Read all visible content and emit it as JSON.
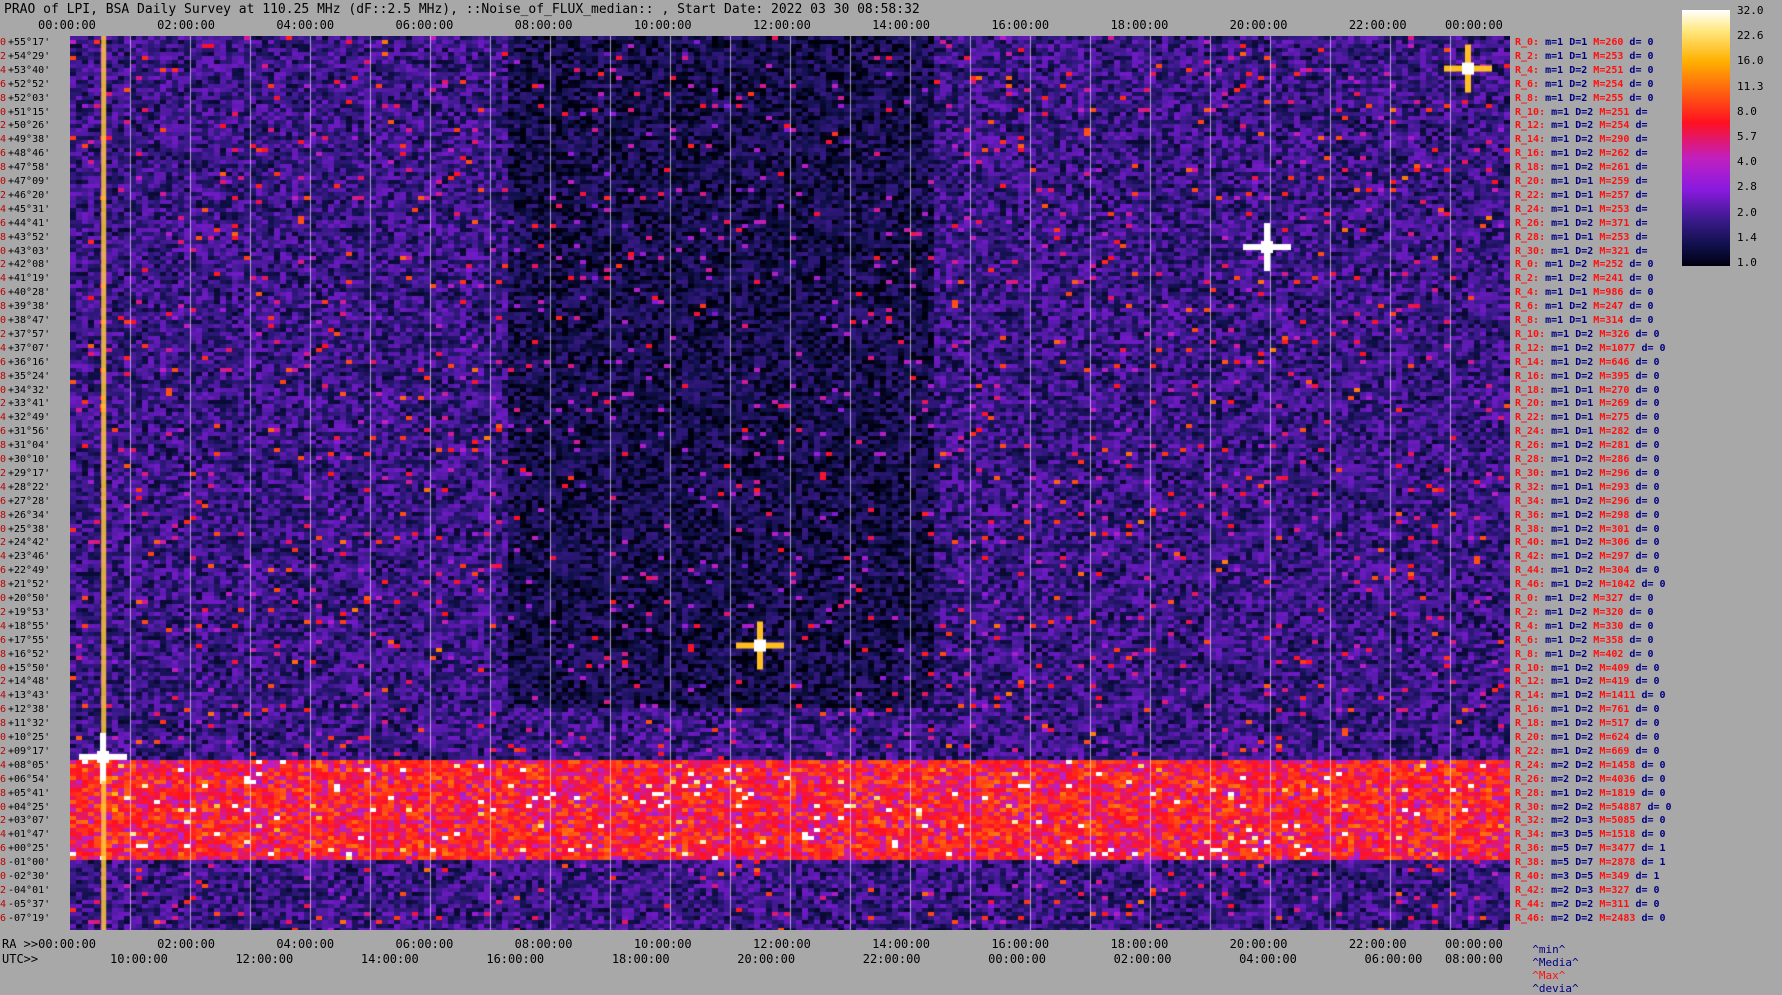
{
  "title": "PRAO of LPI, BSA Daily Survey at 110.25 MHz (dF::2.5 MHz), ::Noise_of_FLUX_median:: , Start Date: 2022 03 30 08:58:32",
  "top_ticks": [
    "00:00:00",
    "02:00:00",
    "04:00:00",
    "06:00:00",
    "08:00:00",
    "10:00:00",
    "12:00:00",
    "14:00:00",
    "16:00:00",
    "18:00:00",
    "20:00:00",
    "22:00:00",
    "00:00:00"
  ],
  "bottom_ra_label": "RA >>00:00:00",
  "bottom_ra_ticks": [
    "02:00:00",
    "04:00:00",
    "06:00:00",
    "08:00:00",
    "10:00:00",
    "12:00:00",
    "14:00:00",
    "16:00:00",
    "18:00:00",
    "20:00:00",
    "22:00:00",
    "00:00:00"
  ],
  "utc_label": "UTC>>",
  "bottom_utc_ticks": [
    "10:00:00",
    "12:00:00",
    "14:00:00",
    "16:00:00",
    "18:00:00",
    "20:00:00",
    "22:00:00",
    "00:00:00",
    "02:00:00",
    "04:00:00",
    "06:00:00",
    "08:00:00"
  ],
  "declinations": [
    "+55°17'",
    "+54°29'",
    "+53°40'",
    "+52°52'",
    "+52°03'",
    "+51°15'",
    "+50°26'",
    "+49°38'",
    "+48°46'",
    "+47°58'",
    "+47°09'",
    "+46°20'",
    "+45°31'",
    "+44°41'",
    "+43°52'",
    "+43°03'",
    "+42°08'",
    "+41°19'",
    "+40°28'",
    "+39°38'",
    "+38°47'",
    "+37°57'",
    "+37°07'",
    "+36°16'",
    "+35°24'",
    "+34°32'",
    "+33°41'",
    "+32°49'",
    "+31°56'",
    "+31°04'",
    "+30°10'",
    "+29°17'",
    "+28°22'",
    "+27°28'",
    "+26°34'",
    "+25°38'",
    "+24°42'",
    "+23°46'",
    "+22°49'",
    "+21°52'",
    "+20°50'",
    "+19°53'",
    "+18°55'",
    "+17°55'",
    "+16°52'",
    "+15°50'",
    "+14°48'",
    "+13°43'",
    "+12°38'",
    "+11°32'",
    "+10°25'",
    "+09°17'",
    "+08°05'",
    "+06°54'",
    "+05°41'",
    "+04°25'",
    "+03°07'",
    "+01°47'",
    "+00°25'",
    "-01°00'",
    "-02°30'",
    "-04°01'",
    "-05°37'",
    "-07°19'"
  ],
  "row_index": [
    "0",
    "2",
    "4",
    "6",
    "8",
    "0",
    "2",
    "4",
    "6",
    "8",
    "0",
    "2",
    "4",
    "6",
    "8",
    "0",
    "2",
    "4",
    "6",
    "8",
    "0",
    "2",
    "4",
    "6",
    "8",
    "0",
    "2",
    "4",
    "6",
    "8",
    "0",
    "2",
    "4",
    "6",
    "8",
    "0",
    "2",
    "4",
    "6",
    "8",
    "0",
    "2",
    "4",
    "6",
    "8",
    "0",
    "2",
    "4",
    "6",
    "8",
    "0",
    "2",
    "4",
    "6",
    "8",
    "0",
    "2",
    "4",
    "6",
    "8",
    "0",
    "2",
    "4",
    "6"
  ],
  "stats": [
    [
      "R_0:",
      "m=1",
      "D=1",
      "M=260",
      "d= 0"
    ],
    [
      "R_2:",
      "m=1",
      "D=1",
      "M=253",
      "d= 0"
    ],
    [
      "R_4:",
      "m=1",
      "D=2",
      "M=251",
      "d= 0"
    ],
    [
      "R_6:",
      "m=1",
      "D=2",
      "M=254",
      "d= 0"
    ],
    [
      "R_8:",
      "m=1",
      "D=2",
      "M=255",
      "d= 0"
    ],
    [
      "R_10:",
      "m=1",
      "D=2",
      "M=251",
      "d="
    ],
    [
      "R_12:",
      "m=1",
      "D=2",
      "M=254",
      "d="
    ],
    [
      "R_14:",
      "m=1",
      "D=2",
      "M=290",
      "d="
    ],
    [
      "R_16:",
      "m=1",
      "D=2",
      "M=262",
      "d="
    ],
    [
      "R_18:",
      "m=1",
      "D=2",
      "M=261",
      "d="
    ],
    [
      "R_20:",
      "m=1",
      "D=1",
      "M=259",
      "d="
    ],
    [
      "R_22:",
      "m=1",
      "D=1",
      "M=257",
      "d="
    ],
    [
      "R_24:",
      "m=1",
      "D=1",
      "M=253",
      "d="
    ],
    [
      "R_26:",
      "m=1",
      "D=2",
      "M=371",
      "d="
    ],
    [
      "R_28:",
      "m=1",
      "D=1",
      "M=253",
      "d="
    ],
    [
      "R_30:",
      "m=1",
      "D=2",
      "M=321",
      "d="
    ],
    [
      "R_0:",
      "m=1",
      "D=2",
      "M=252",
      "d= 0"
    ],
    [
      "R_2:",
      "m=1",
      "D=2",
      "M=241",
      "d= 0"
    ],
    [
      "R_4:",
      "m=1",
      "D=1",
      "M=986",
      "d= 0"
    ],
    [
      "R_6:",
      "m=1",
      "D=2",
      "M=247",
      "d= 0"
    ],
    [
      "R_8:",
      "m=1",
      "D=1",
      "M=314",
      "d= 0"
    ],
    [
      "R_10:",
      "m=1",
      "D=2",
      "M=326",
      "d= 0"
    ],
    [
      "R_12:",
      "m=1",
      "D=2",
      "M=1077",
      "d= 0"
    ],
    [
      "R_14:",
      "m=1",
      "D=2",
      "M=646",
      "d= 0"
    ],
    [
      "R_16:",
      "m=1",
      "D=2",
      "M=395",
      "d= 0"
    ],
    [
      "R_18:",
      "m=1",
      "D=1",
      "M=270",
      "d= 0"
    ],
    [
      "R_20:",
      "m=1",
      "D=1",
      "M=269",
      "d= 0"
    ],
    [
      "R_22:",
      "m=1",
      "D=1",
      "M=275",
      "d= 0"
    ],
    [
      "R_24:",
      "m=1",
      "D=1",
      "M=282",
      "d= 0"
    ],
    [
      "R_26:",
      "m=1",
      "D=2",
      "M=281",
      "d= 0"
    ],
    [
      "R_28:",
      "m=1",
      "D=2",
      "M=286",
      "d= 0"
    ],
    [
      "R_30:",
      "m=1",
      "D=2",
      "M=296",
      "d= 0"
    ],
    [
      "R_32:",
      "m=1",
      "D=1",
      "M=293",
      "d= 0"
    ],
    [
      "R_34:",
      "m=1",
      "D=2",
      "M=296",
      "d= 0"
    ],
    [
      "R_36:",
      "m=1",
      "D=2",
      "M=298",
      "d= 0"
    ],
    [
      "R_38:",
      "m=1",
      "D=2",
      "M=301",
      "d= 0"
    ],
    [
      "R_40:",
      "m=1",
      "D=2",
      "M=306",
      "d= 0"
    ],
    [
      "R_42:",
      "m=1",
      "D=2",
      "M=297",
      "d= 0"
    ],
    [
      "R_44:",
      "m=1",
      "D=2",
      "M=304",
      "d= 0"
    ],
    [
      "R_46:",
      "m=1",
      "D=2",
      "M=1042",
      "d= 0"
    ],
    [
      "R_0:",
      "m=1",
      "D=2",
      "M=327",
      "d= 0"
    ],
    [
      "R_2:",
      "m=1",
      "D=2",
      "M=320",
      "d= 0"
    ],
    [
      "R_4:",
      "m=1",
      "D=2",
      "M=330",
      "d= 0"
    ],
    [
      "R_6:",
      "m=1",
      "D=2",
      "M=358",
      "d= 0"
    ],
    [
      "R_8:",
      "m=1",
      "D=2",
      "M=402",
      "d= 0"
    ],
    [
      "R_10:",
      "m=1",
      "D=2",
      "M=409",
      "d= 0"
    ],
    [
      "R_12:",
      "m=1",
      "D=2",
      "M=419",
      "d= 0"
    ],
    [
      "R_14:",
      "m=1",
      "D=2",
      "M=1411",
      "d= 0"
    ],
    [
      "R_16:",
      "m=1",
      "D=2",
      "M=761",
      "d= 0"
    ],
    [
      "R_18:",
      "m=1",
      "D=2",
      "M=517",
      "d= 0"
    ],
    [
      "R_20:",
      "m=1",
      "D=2",
      "M=624",
      "d= 0"
    ],
    [
      "R_22:",
      "m=1",
      "D=2",
      "M=669",
      "d= 0"
    ],
    [
      "R_24:",
      "m=2",
      "D=2",
      "M=1458",
      "d= 0"
    ],
    [
      "R_26:",
      "m=2",
      "D=2",
      "M=4036",
      "d= 0"
    ],
    [
      "R_28:",
      "m=1",
      "D=2",
      "M=1819",
      "d= 0"
    ],
    [
      "R_30:",
      "m=2",
      "D=2",
      "M=54887",
      "d= 0"
    ],
    [
      "R_32:",
      "m=2",
      "D=3",
      "M=5085",
      "d= 0"
    ],
    [
      "R_34:",
      "m=3",
      "D=5",
      "M=1518",
      "d= 0"
    ],
    [
      "R_36:",
      "m=5",
      "D=7",
      "M=3477",
      "d= 1"
    ],
    [
      "R_38:",
      "m=5",
      "D=7",
      "M=2878",
      "d= 1"
    ],
    [
      "R_40:",
      "m=3",
      "D=5",
      "M=349",
      "d= 1"
    ],
    [
      "R_42:",
      "m=2",
      "D=3",
      "M=327",
      "d= 0"
    ],
    [
      "R_44:",
      "m=2",
      "D=2",
      "M=311",
      "d= 0"
    ],
    [
      "R_46:",
      "m=2",
      "D=2",
      "M=2483",
      "d= 0"
    ]
  ],
  "stats_legend": {
    "min": "^min^",
    "median": "^Media^",
    "max": "^Max^",
    "devia": "^devia^"
  },
  "colorbar_ticks": [
    "32.0",
    "22.6",
    "16.0",
    "11.3",
    "8.0",
    "5.7",
    "4.0",
    "2.8",
    "2.0",
    "1.4",
    "1.0"
  ],
  "chart_data": {
    "type": "heatmap",
    "title": "PRAO of LPI, BSA Daily Survey at 110.25 MHz (dF::2.5 MHz), ::Noise_of_FLUX_median:: , Start Date: 2022 03 30 08:58:32",
    "x_axis_ra_hours": [
      0,
      24
    ],
    "y_axis_dec_deg": [
      55.28,
      -7.32
    ],
    "color_scale": "log",
    "color_range": [
      1.0,
      32.0
    ],
    "features": [
      {
        "ra_hours": 0.55,
        "dec_deg": 4.8,
        "intensity": 32
      },
      {
        "ra_hours": 19.95,
        "dec_deg": 40.5,
        "intensity": 32
      },
      {
        "ra_hours": 11.5,
        "dec_deg": 12.6,
        "intensity": 22
      },
      {
        "ra_hours": 23.3,
        "dec_deg": 53.0,
        "intensity": 22
      }
    ],
    "galactic_plane_band_dec_deg": [
      -1.5,
      2.5
    ],
    "background_level": 2.0
  },
  "colors": {
    "background": "#a8a8a8",
    "stat_label": "#ff1010",
    "stat_value": "#000080"
  }
}
